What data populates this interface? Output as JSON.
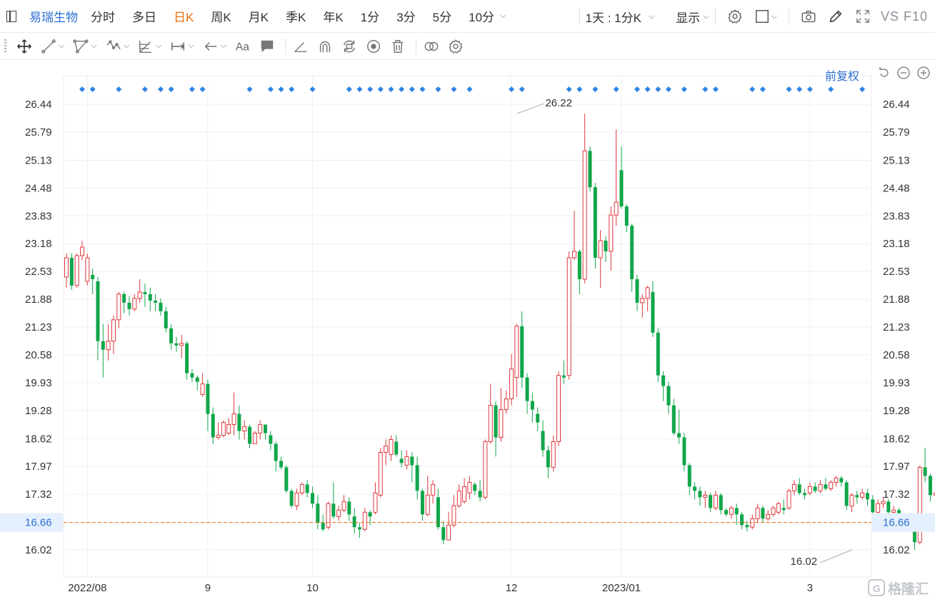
{
  "stock_name": "易瑞生物",
  "periods": [
    "分时",
    "多日",
    "日K",
    "周K",
    "月K",
    "季K",
    "年K",
    "1分",
    "3分",
    "5分",
    "10分"
  ],
  "active_period": "日K",
  "combo_label": "1天 : 1分K",
  "display_label": "显示",
  "vs_label": "VS F10",
  "adjust_label": "前复权",
  "watermark": "格隆汇",
  "icons": {
    "top": [
      "sidebar-icon",
      "settings-gear-icon",
      "square-icon",
      "camera-icon",
      "pencil-icon",
      "fullscreen-icon"
    ],
    "draw": [
      "move-icon",
      "line-icon",
      "channel-icon",
      "wave-icon",
      "fibonacci-icon",
      "range-icon",
      "arrow-icon",
      "text-icon",
      "note-icon",
      "angle-icon",
      "arc-icon",
      "rotate-icon",
      "eye-icon",
      "trash-icon",
      "link-icon",
      "gear-icon"
    ]
  },
  "colors": {
    "up": "#e0373a",
    "down": "#10a64a",
    "accent": "#2d6fd1",
    "active": "#ef6d10",
    "current_line": "#ef6d10",
    "marker": "#2f84e4"
  },
  "chart_data": {
    "type": "candlestick",
    "y_ticks": [
      "26.44",
      "25.79",
      "25.13",
      "24.48",
      "23.83",
      "23.18",
      "22.53",
      "21.88",
      "21.23",
      "20.58",
      "19.93",
      "19.28",
      "18.62",
      "17.97",
      "17.32",
      "16.66",
      "16.02"
    ],
    "ylim": [
      15.43,
      26.62
    ],
    "current_price": "16.66",
    "x_labels": [
      {
        "label": "2022/08",
        "index": 4
      },
      {
        "label": "9",
        "index": 27
      },
      {
        "label": "10",
        "index": 47
      },
      {
        "label": "12",
        "index": 85
      },
      {
        "label": "2023/01",
        "index": 106
      },
      {
        "label": "3",
        "index": 142
      }
    ],
    "high_label": {
      "value": "26.22",
      "index": 86
    },
    "low_label": {
      "value": "16.02",
      "index": 150
    },
    "event_marker_indices": [
      3,
      5,
      10,
      15,
      18,
      20,
      24,
      26,
      35,
      39,
      41,
      43,
      47,
      54,
      56,
      58,
      60,
      62,
      64,
      66,
      68,
      71,
      74,
      77,
      85,
      87,
      96,
      98,
      101,
      105,
      109,
      111,
      113,
      115,
      118,
      122,
      124,
      131,
      133,
      138,
      140,
      142,
      146,
      152
    ],
    "candles": [
      [
        22.4,
        22.85,
        22.95,
        22.15
      ],
      [
        22.85,
        22.2,
        22.95,
        22.1
      ],
      [
        22.2,
        22.9,
        22.95,
        22.15
      ],
      [
        22.9,
        23.1,
        23.25,
        22.8
      ],
      [
        22.3,
        22.85,
        22.95,
        22.2
      ],
      [
        22.45,
        22.35,
        22.6,
        22.0
      ],
      [
        22.3,
        20.9,
        22.4,
        20.45
      ],
      [
        20.9,
        20.7,
        21.3,
        20.05
      ],
      [
        20.7,
        20.9,
        21.3,
        20.45
      ],
      [
        20.9,
        21.4,
        21.5,
        20.6
      ],
      [
        21.4,
        22.0,
        22.05,
        21.2
      ],
      [
        22.0,
        21.8,
        22.05,
        21.55
      ],
      [
        21.8,
        21.65,
        21.95,
        21.5
      ],
      [
        21.65,
        21.9,
        22.0,
        21.6
      ],
      [
        21.9,
        22.05,
        22.35,
        21.8
      ],
      [
        22.05,
        22.0,
        22.25,
        21.7
      ],
      [
        22.0,
        21.85,
        22.15,
        21.6
      ],
      [
        21.85,
        21.8,
        22.0,
        21.6
      ],
      [
        21.8,
        21.6,
        21.9,
        21.5
      ],
      [
        21.6,
        21.2,
        21.7,
        21.1
      ],
      [
        21.2,
        20.85,
        21.3,
        20.7
      ],
      [
        20.85,
        20.8,
        21.0,
        20.65
      ],
      [
        20.8,
        20.85,
        21.05,
        20.5
      ],
      [
        20.85,
        20.15,
        20.9,
        20.0
      ],
      [
        20.15,
        20.05,
        20.25,
        19.95
      ],
      [
        20.05,
        19.95,
        20.1,
        19.75
      ],
      [
        19.65,
        19.9,
        20.15,
        19.6
      ],
      [
        19.9,
        19.2,
        20.0,
        18.8
      ],
      [
        19.2,
        18.65,
        19.35,
        18.5
      ],
      [
        18.65,
        18.7,
        19.0,
        18.6
      ],
      [
        18.7,
        19.0,
        19.05,
        18.65
      ],
      [
        18.75,
        18.95,
        19.1,
        18.7
      ],
      [
        18.95,
        19.2,
        19.7,
        18.7
      ],
      [
        19.2,
        18.8,
        19.4,
        18.6
      ],
      [
        18.8,
        18.9,
        19.05,
        18.6
      ],
      [
        18.9,
        18.5,
        18.95,
        18.4
      ],
      [
        18.5,
        18.75,
        18.8,
        18.55
      ],
      [
        18.75,
        18.95,
        19.05,
        18.6
      ],
      [
        18.95,
        18.75,
        18.95,
        18.6
      ],
      [
        18.7,
        18.5,
        18.8,
        18.35
      ],
      [
        18.5,
        18.1,
        18.55,
        17.85
      ],
      [
        18.1,
        17.95,
        18.2,
        17.9
      ],
      [
        17.95,
        17.4,
        18.0,
        17.35
      ],
      [
        17.4,
        17.05,
        17.45,
        17.0
      ],
      [
        17.05,
        17.35,
        17.45,
        16.95
      ],
      [
        17.35,
        17.55,
        17.6,
        17.3
      ],
      [
        17.55,
        17.35,
        17.65,
        17.25
      ],
      [
        17.35,
        17.1,
        17.5,
        17.0
      ],
      [
        17.1,
        16.65,
        17.3,
        16.5
      ],
      [
        16.65,
        16.5,
        16.85,
        16.45
      ],
      [
        16.55,
        17.1,
        17.15,
        16.5
      ],
      [
        17.1,
        16.8,
        17.6,
        16.75
      ],
      [
        16.8,
        16.95,
        17.05,
        16.7
      ],
      [
        16.95,
        17.15,
        17.3,
        16.9
      ],
      [
        17.15,
        16.85,
        17.25,
        16.7
      ],
      [
        16.8,
        16.55,
        17.0,
        16.4
      ],
      [
        16.55,
        16.5,
        16.65,
        16.3
      ],
      [
        16.5,
        16.9,
        17.0,
        16.45
      ],
      [
        16.9,
        16.8,
        16.95,
        16.6
      ],
      [
        16.9,
        17.35,
        17.6,
        16.85
      ],
      [
        17.3,
        18.3,
        18.4,
        17.25
      ],
      [
        18.3,
        18.45,
        18.6,
        18.0
      ],
      [
        18.25,
        18.6,
        18.7,
        18.1
      ],
      [
        18.55,
        18.25,
        18.7,
        18.2
      ],
      [
        18.15,
        18.05,
        18.35,
        17.95
      ],
      [
        18.0,
        18.2,
        18.35,
        17.9
      ],
      [
        18.2,
        18.0,
        18.3,
        17.6
      ],
      [
        18.0,
        17.4,
        18.2,
        17.2
      ],
      [
        17.4,
        16.85,
        17.45,
        16.7
      ],
      [
        16.85,
        17.3,
        17.75,
        16.8
      ],
      [
        17.3,
        17.55,
        17.65,
        17.1
      ],
      [
        17.25,
        16.55,
        17.45,
        16.5
      ],
      [
        16.55,
        16.25,
        16.7,
        16.15
      ],
      [
        16.25,
        16.6,
        16.9,
        16.25
      ],
      [
        16.6,
        17.05,
        17.3,
        16.55
      ],
      [
        17.05,
        17.4,
        17.55,
        17.0
      ],
      [
        17.15,
        17.5,
        17.7,
        17.1
      ],
      [
        17.35,
        17.6,
        17.75,
        17.2
      ],
      [
        17.55,
        17.4,
        17.6,
        17.3
      ],
      [
        17.4,
        17.25,
        17.65,
        17.15
      ],
      [
        17.25,
        18.55,
        18.6,
        17.2
      ],
      [
        18.55,
        19.4,
        19.9,
        18.5
      ],
      [
        19.4,
        18.65,
        19.5,
        18.2
      ],
      [
        18.65,
        19.3,
        19.8,
        18.55
      ],
      [
        19.3,
        19.55,
        19.75,
        19.2
      ],
      [
        19.55,
        20.25,
        20.6,
        19.4
      ],
      [
        20.05,
        21.25,
        21.3,
        19.6
      ],
      [
        21.25,
        20.05,
        21.6,
        19.8
      ],
      [
        20.05,
        19.5,
        20.15,
        19.2
      ],
      [
        19.5,
        19.3,
        19.7,
        19.0
      ],
      [
        19.2,
        19.0,
        19.35,
        18.8
      ],
      [
        18.8,
        18.35,
        19.05,
        18.2
      ],
      [
        18.35,
        17.95,
        18.45,
        17.7
      ],
      [
        17.95,
        18.55,
        18.7,
        17.85
      ],
      [
        18.55,
        20.1,
        20.2,
        18.45
      ],
      [
        20.1,
        20.05,
        20.45,
        19.9
      ],
      [
        20.1,
        22.85,
        23.0,
        20.0
      ],
      [
        22.85,
        23.0,
        23.95,
        22.8
      ],
      [
        23.0,
        22.35,
        23.05,
        22.0
      ],
      [
        22.35,
        25.35,
        26.22,
        22.25
      ],
      [
        25.35,
        24.5,
        25.45,
        24.4
      ],
      [
        24.5,
        22.85,
        24.6,
        22.6
      ],
      [
        22.85,
        23.25,
        23.5,
        22.15
      ],
      [
        23.25,
        23.0,
        23.35,
        22.75
      ],
      [
        23.0,
        23.85,
        24.05,
        22.55
      ],
      [
        23.85,
        24.15,
        25.85,
        23.6
      ],
      [
        24.9,
        24.05,
        25.45,
        24.0
      ],
      [
        24.05,
        23.6,
        24.1,
        23.45
      ],
      [
        23.6,
        22.35,
        23.65,
        22.05
      ],
      [
        22.35,
        21.8,
        22.45,
        21.6
      ],
      [
        21.8,
        21.9,
        22.0,
        21.45
      ],
      [
        21.9,
        22.15,
        22.2,
        21.6
      ],
      [
        22.05,
        21.1,
        22.3,
        21.0
      ],
      [
        21.1,
        20.1,
        21.2,
        19.95
      ],
      [
        20.1,
        19.85,
        20.2,
        19.5
      ],
      [
        19.85,
        19.4,
        19.95,
        19.2
      ],
      [
        19.4,
        18.75,
        19.55,
        18.7
      ],
      [
        18.75,
        18.65,
        19.3,
        18.5
      ],
      [
        18.65,
        18.0,
        18.75,
        17.85
      ],
      [
        18.0,
        17.5,
        18.05,
        17.3
      ],
      [
        17.5,
        17.4,
        17.6,
        17.2
      ],
      [
        17.4,
        17.25,
        17.5,
        17.05
      ],
      [
        17.25,
        17.3,
        17.4,
        17.0
      ],
      [
        17.3,
        17.0,
        17.35,
        16.9
      ],
      [
        17.0,
        17.3,
        17.4,
        16.95
      ],
      [
        17.3,
        16.95,
        17.35,
        16.85
      ],
      [
        16.95,
        16.85,
        17.0,
        16.8
      ],
      [
        16.85,
        17.0,
        17.05,
        16.75
      ],
      [
        17.0,
        16.85,
        17.1,
        16.6
      ],
      [
        16.85,
        16.6,
        16.9,
        16.5
      ],
      [
        16.6,
        16.55,
        16.7,
        16.45
      ],
      [
        16.55,
        16.75,
        16.85,
        16.5
      ],
      [
        16.75,
        17.0,
        17.1,
        16.65
      ],
      [
        17.0,
        16.75,
        17.05,
        16.65
      ],
      [
        16.75,
        16.85,
        16.95,
        16.7
      ],
      [
        16.85,
        17.0,
        17.05,
        16.8
      ],
      [
        16.9,
        17.1,
        17.15,
        16.85
      ],
      [
        17.0,
        16.95,
        17.2,
        16.85
      ],
      [
        17.0,
        17.4,
        17.45,
        16.95
      ],
      [
        17.4,
        17.55,
        17.65,
        17.3
      ],
      [
        17.55,
        17.35,
        17.7,
        17.3
      ],
      [
        17.35,
        17.3,
        17.45,
        17.2
      ],
      [
        17.35,
        17.5,
        17.6,
        17.3
      ],
      [
        17.5,
        17.4,
        17.6,
        17.35
      ],
      [
        17.4,
        17.55,
        17.65,
        17.35
      ],
      [
        17.55,
        17.45,
        17.7,
        17.4
      ],
      [
        17.45,
        17.6,
        17.65,
        17.4
      ],
      [
        17.6,
        17.7,
        17.75,
        17.5
      ],
      [
        17.7,
        17.6,
        17.75,
        17.5
      ],
      [
        17.6,
        17.05,
        17.65,
        16.95
      ],
      [
        17.05,
        17.3,
        17.35,
        16.9
      ],
      [
        17.3,
        17.25,
        17.4,
        17.1
      ],
      [
        17.25,
        17.35,
        17.45,
        17.2
      ],
      [
        17.35,
        17.2,
        17.45,
        17.05
      ],
      [
        17.2,
        16.9,
        17.3,
        16.85
      ],
      [
        16.9,
        17.1,
        17.2,
        16.85
      ],
      [
        17.1,
        17.15,
        17.25,
        17.0
      ],
      [
        17.15,
        16.9,
        17.2,
        16.8
      ],
      [
        16.9,
        16.95,
        17.05,
        16.85
      ],
      [
        16.95,
        16.7,
        17.0,
        16.65
      ],
      [
        16.7,
        16.55,
        16.8,
        16.5
      ],
      [
        16.55,
        16.75,
        16.85,
        16.45
      ],
      [
        16.75,
        16.2,
        16.8,
        16.02
      ],
      [
        16.2,
        17.95,
        18.0,
        16.15
      ],
      [
        17.95,
        17.75,
        18.4,
        17.6
      ],
      [
        17.75,
        17.3,
        17.8,
        17.15
      ],
      [
        17.3,
        17.35,
        17.45,
        17.2
      ],
      [
        17.35,
        16.66,
        17.4,
        16.55
      ]
    ]
  }
}
